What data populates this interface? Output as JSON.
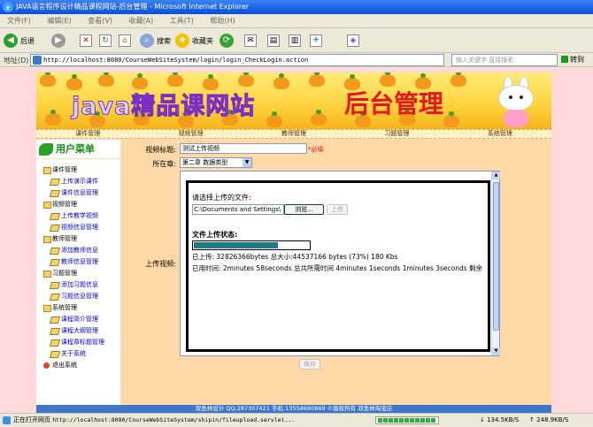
{
  "window": {
    "title": "JAVA语言程序设计精品课程网站-后台管理 - Microsoft Internet Explorer"
  },
  "menu": [
    "文件(F)",
    "编辑(E)",
    "查看(V)",
    "收藏(A)",
    "工具(T)",
    "帮助(H)"
  ],
  "toolbar": {
    "back": "后退",
    "search": "搜索",
    "favorites": "收藏夹"
  },
  "address": {
    "label": "地址(D)",
    "url": "http://localhost:8080/CourseWebSiteSystem/login/login_CheckLogin.action",
    "search_placeholder": "输入关键字 直接搜索",
    "go": "转到"
  },
  "banner": {
    "title_java": "java精品课网站",
    "title_admin": "后台管理"
  },
  "nav": [
    "课件管理",
    "视频管理",
    "教师管理",
    "习题管理",
    "系统管理"
  ],
  "sidebar": {
    "header": "用户菜单",
    "groups": [
      {
        "label": "课件管理",
        "items": [
          "上传演示课件",
          "课件信息管理"
        ]
      },
      {
        "label": "视频管理",
        "items": [
          "上传教学视频",
          "视频信息管理"
        ]
      },
      {
        "label": "教师管理",
        "items": [
          "添加教师信息",
          "教师信息管理"
        ]
      },
      {
        "label": "习题管理",
        "items": [
          "添加习题信息",
          "习题信息管理"
        ]
      },
      {
        "label": "系统管理",
        "items": [
          "课程简介管理",
          "课程大纲管理",
          "课程章标题管理",
          "关于系统"
        ]
      }
    ],
    "exit": "退出系统"
  },
  "form": {
    "video_title_label": "视频标题:",
    "video_title_value": "测试上传视频",
    "required": "*必填",
    "chapter_label": "所在章:",
    "chapter_value": "第二章 数据类型",
    "upload_label": "上传视频:",
    "choose_file_label": "请选择上传的文件:",
    "file_path": "C:\\Documents and Settings\\",
    "browse": "浏览...",
    "upload": "上传",
    "status_title": "文件上传状态:",
    "progress": 0.73,
    "uploaded_line": "已上传: 32826366bytes 总大小:44537166 bytes (73%) 180 Kbs",
    "time_line": "已用时间: 2minutes 58seconds 总共所需时间  4minutes 1seconds 1minutes 3seconds 剩余",
    "save": "保存"
  },
  "footer": "双鱼林设计 QQ:287307421 手机:13558690869 ©版权所有 双鱼林淘宝店",
  "statusbar": {
    "message": "正在打开网页 ",
    "url": "http://localhost:8080/CourseWebSiteSystem/shipin/fileupload.servlet...",
    "download": "134.5KB/S",
    "upload": "248.9KB/S"
  },
  "colors": {
    "title_bar": "#0a4fd6",
    "page_bg": "#ffd9dc",
    "content_bg": "#ffd8a8",
    "progress": "#1f7b88",
    "required": "#dd1111",
    "footer": "#3d77c9"
  }
}
